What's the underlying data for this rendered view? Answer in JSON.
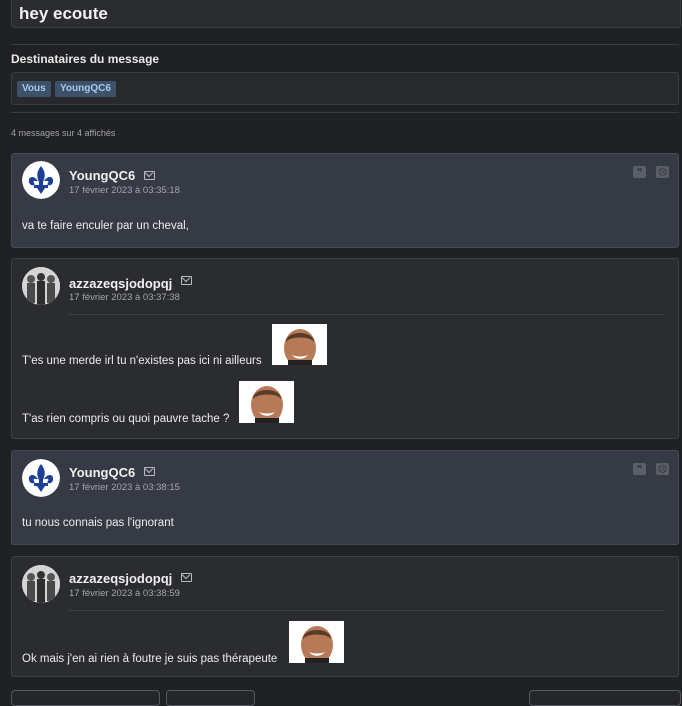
{
  "subject": {
    "title": "hey ecoute"
  },
  "recipients": {
    "label": "Destinataires du message",
    "items": [
      "Vous",
      "YoungQC6"
    ]
  },
  "summary": "4 messages sur 4 affichés",
  "messages": [
    {
      "author": "YoungQC6",
      "date": "17 février 2023 à 03:35:18",
      "lines": [
        "va te faire enculer par un cheval,"
      ],
      "avatar": "fleur-de-lis-icon"
    },
    {
      "author": "azzazeqsjodopqj",
      "date": "17 février 2023 à 03:37:38",
      "lines": [
        "T'es une merde irl tu n'existes pas ici ni ailleurs",
        "T'as rien compris ou quoi pauvre tache ?"
      ],
      "avatar": "group-photo"
    },
    {
      "author": "YoungQC6",
      "date": "17 février 2023 à 03:38:15",
      "lines": [
        "tu nous connais pas l'ignorant"
      ],
      "avatar": "fleur-de-lis-icon"
    },
    {
      "author": "azzazeqsjodopqj",
      "date": "17 février 2023 à 03:38:59",
      "lines": [
        "Ok mais j'en ai rien à foutre je suis pas thérapeute"
      ],
      "avatar": "group-photo"
    }
  ],
  "icons": {
    "quote": "quote-icon",
    "report": "report-icon",
    "mail": "mail-icon"
  },
  "colors": {
    "background": "#202124",
    "chip_bg": "#3d5168",
    "chip_text": "#a9c9ef",
    "alt_message_bg": "#363a44"
  }
}
